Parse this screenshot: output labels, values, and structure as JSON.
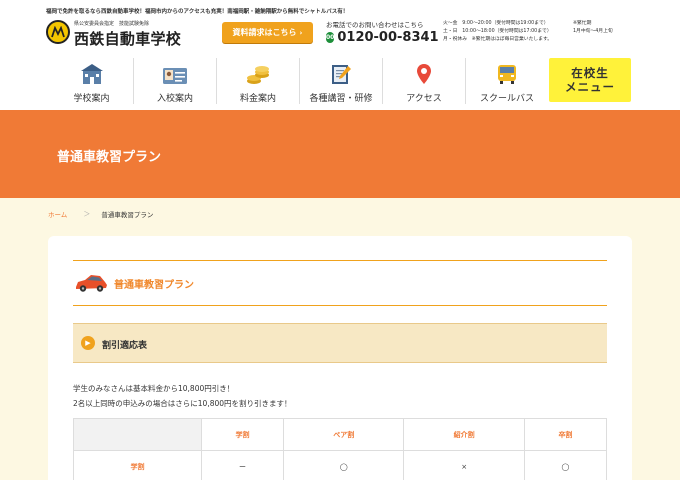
{
  "header": {
    "tagline": "福岡で免許を取るなら西鉄自動車学校！福岡市内からのアクセスも充実！南福岡駅・雑餉隈駅から無料でシャトルバス有！",
    "logo_sub": "県公安委員会指定　技能試験免除",
    "logo_main": "西鉄自動車学校",
    "request_button": "資料請求はこちら",
    "phone_label": "お電話でのお問い合わせはこちら",
    "phone_icon": "free-dial-icon",
    "phone_icon_text": "00",
    "phone_number": "0120-00-8341",
    "hours_line1": "火〜金　9:00〜20:00（受付時間は19:00まで）",
    "hours_line2": "土・日　10:00〜18:00（受付時間は17:00まで）",
    "hours_line3": "月・祝休み　※繁忙期はほぼ毎日営業いたします。",
    "busy_line1": "※繁忙期",
    "busy_line2": "1月中旬〜4月上旬"
  },
  "nav": {
    "items": [
      {
        "label": "学校案内",
        "icon": "school-building-icon"
      },
      {
        "label": "入校案内",
        "icon": "id-card-icon"
      },
      {
        "label": "料金案内",
        "icon": "coins-icon"
      },
      {
        "label": "各種講習・研修",
        "icon": "notebook-pen-icon"
      },
      {
        "label": "アクセス",
        "icon": "map-pin-icon"
      },
      {
        "label": "スクールバス",
        "icon": "school-bus-icon"
      }
    ],
    "member_line1": "在校生",
    "member_line2": "メニュー"
  },
  "hero": {
    "title": "普通車教習プラン"
  },
  "breadcrumb": {
    "home": "ホーム",
    "separator": "＞",
    "current": "普通車教習プラン"
  },
  "content": {
    "section_title": "普通車教習プラン",
    "sub_heading": "割引適応表",
    "sub_heading_arrow": "▶",
    "description_line1": "学生のみなさんは基本料金から10,800円引き！",
    "description_line2": "2名以上同時の申込みの場合はさらに10,800円を割り引きます！",
    "table": {
      "columns": [
        "学割",
        "ペア割",
        "紹介割",
        "卒割"
      ],
      "rows": [
        {
          "label": "学割",
          "cells": [
            "ー",
            "◯",
            "×",
            "◯"
          ]
        }
      ]
    }
  },
  "colors": {
    "accent_orange": "#f07a36",
    "button_orange": "#f0a21d",
    "member_yellow": "#fff23a",
    "page_background": "#fdf8e2"
  }
}
